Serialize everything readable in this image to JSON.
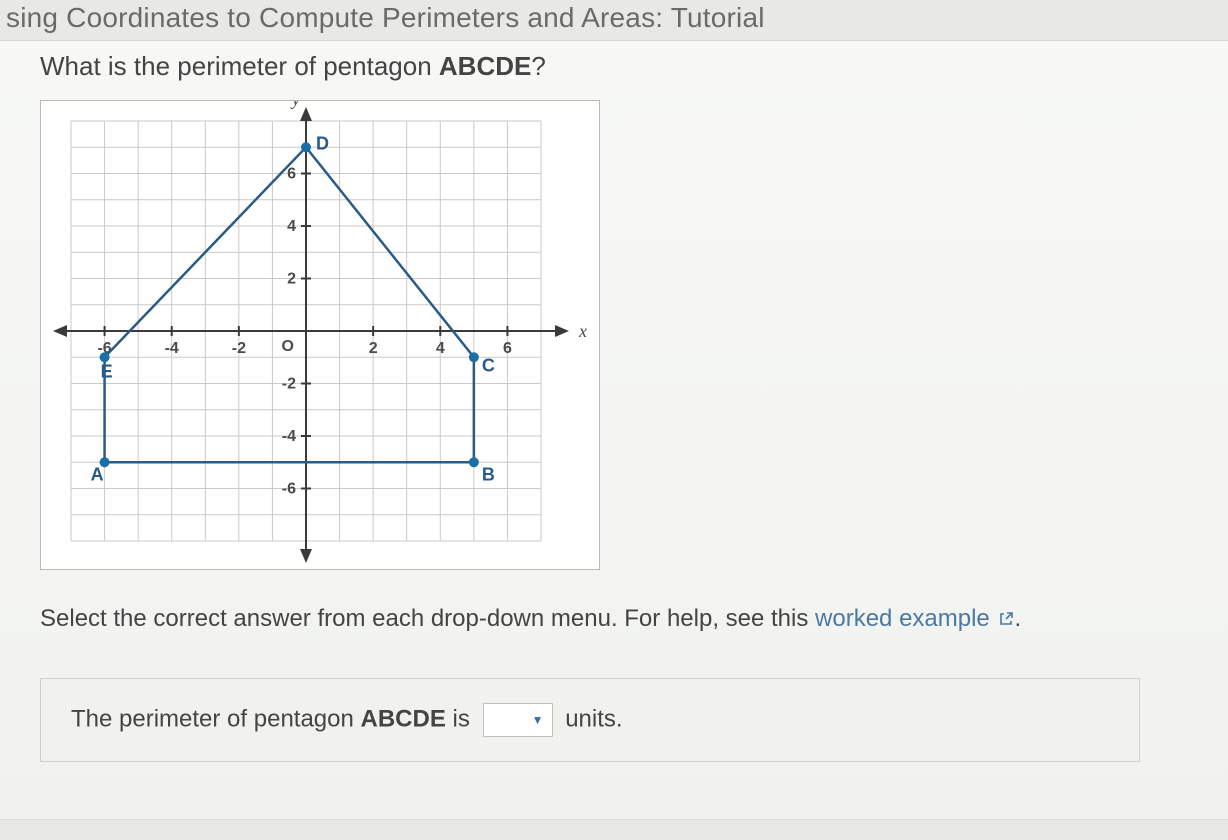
{
  "header": {
    "page_title": "sing Coordinates to Compute Perimeters and Areas: Tutorial"
  },
  "question": {
    "prefix": "What is the perimeter of pentagon ",
    "shape_name": "ABCDE",
    "suffix": "?"
  },
  "instruction": {
    "text": "Select the correct answer from each drop-down menu. For help, see this ",
    "link_text": "worked example",
    "link_icon_name": "external-link-icon",
    "link_trailing": "."
  },
  "answer": {
    "prefix": "The perimeter of pentagon ",
    "shape_name": "ABCDE",
    "mid": " is",
    "units_label": "units."
  },
  "chart_data": {
    "type": "scatter",
    "title": "",
    "xlabel": "x",
    "ylabel": "y",
    "xlim": [
      -7,
      7
    ],
    "ylim": [
      -8,
      8
    ],
    "x_ticks": [
      -6,
      -4,
      -2,
      2,
      4,
      6
    ],
    "y_ticks": [
      -6,
      -4,
      -2,
      2,
      4,
      6
    ],
    "origin_label": "O",
    "points": [
      {
        "name": "A",
        "x": -6,
        "y": -5,
        "label_dx": -14,
        "label_dy": 18
      },
      {
        "name": "B",
        "x": 5,
        "y": -5,
        "label_dx": 8,
        "label_dy": 18
      },
      {
        "name": "C",
        "x": 5,
        "y": -1,
        "label_dx": 8,
        "label_dy": 14
      },
      {
        "name": "D",
        "x": 0,
        "y": 7,
        "label_dx": 10,
        "label_dy": 2
      },
      {
        "name": "E",
        "x": -6,
        "y": -1,
        "label_dx": -4,
        "label_dy": 20
      }
    ],
    "polygon_order": [
      "A",
      "B",
      "C",
      "D",
      "E"
    ]
  }
}
